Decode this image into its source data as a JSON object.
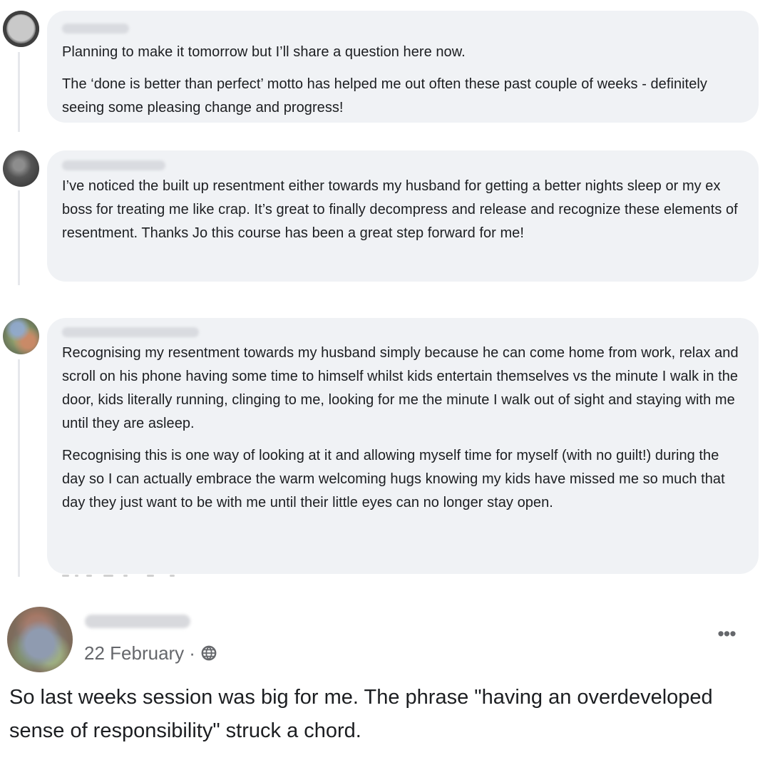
{
  "comments": [
    {
      "paragraphs": [
        "Planning to make it tomorrow but I’ll share a question here now.",
        "The ‘done is better than perfect’ motto has helped me out often these past couple of weeks - definitely seeing some pleasing change and progress!"
      ]
    },
    {
      "paragraphs": [
        "I’ve noticed the built up resentment either towards my husband for getting a better nights sleep or my ex boss for treating me like crap. It’s great to finally decompress and release and recognize these elements of resentment. Thanks Jo this course has been a great step forward for me!"
      ]
    },
    {
      "paragraphs": [
        "Recognising my resentment towards my husband simply because he can come home from work, relax and scroll on his phone having some time to himself whilst kids entertain themselves vs the minute I walk in the door, kids literally running, clinging to me, looking for me the minute I walk out of sight and staying with me until they are asleep.",
        "Recognising this is one way of looking at it and allowing myself time for myself (with no guilt!) during the day so I can actually embrace the warm welcoming hugs knowing my kids have missed me so much that day they just want to be with me until their little eyes can no longer stay open."
      ]
    }
  ],
  "post": {
    "date": "22 February",
    "separator": "·",
    "privacy_icon": "globe-icon",
    "more_icon": "more-options-icon",
    "more_label": "•••",
    "body": "So last weeks session was big for me. The phrase \"having an overdeveloped sense of responsibility\" struck a chord."
  },
  "colors": {
    "bubble_background": "#f0f2f5",
    "primary_text": "#1c1e21",
    "secondary_text": "#65676b",
    "thread_line": "#e6e8ec"
  }
}
